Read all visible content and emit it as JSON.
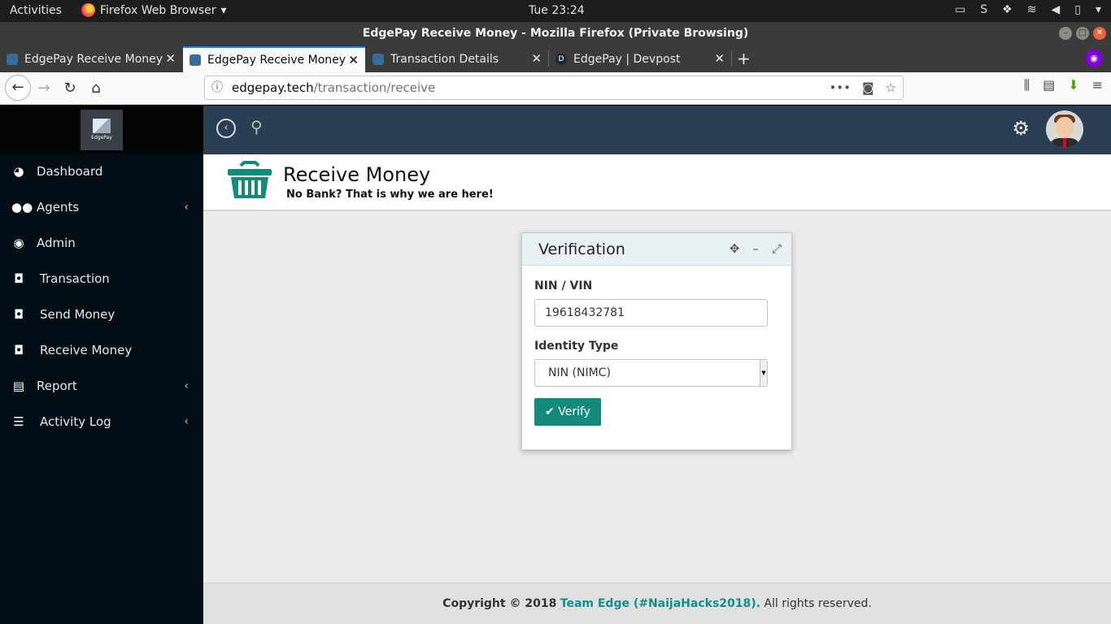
{
  "system": {
    "activities": "Activities",
    "app_menu": "Firefox Web Browser",
    "clock": "Tue 23:24"
  },
  "window": {
    "title": "EdgePay Receive Money - Mozilla Firefox (Private Browsing)"
  },
  "tabs": [
    {
      "label": "EdgePay Receive Money",
      "active": false
    },
    {
      "label": "EdgePay Receive Money",
      "active": true
    },
    {
      "label": "Transaction Details",
      "active": false
    },
    {
      "label": "EdgePay | Devpost",
      "active": false
    }
  ],
  "url": {
    "host": "edgepay.tech",
    "path": "/transaction/receive"
  },
  "brand": {
    "name": "EdgePay"
  },
  "sidebar": {
    "items": [
      {
        "label": "Dashboard",
        "icon": "dashboard-icon",
        "has_submenu": false
      },
      {
        "label": "Agents",
        "icon": "users-icon",
        "has_submenu": true
      },
      {
        "label": "Admin",
        "icon": "user-circle-icon",
        "has_submenu": false
      },
      {
        "label": "Transaction",
        "icon": "circle-dot-icon",
        "has_submenu": false
      },
      {
        "label": "Send Money",
        "icon": "circle-dot-icon",
        "has_submenu": false
      },
      {
        "label": "Receive Money",
        "icon": "circle-dot-icon",
        "has_submenu": false
      },
      {
        "label": "Report",
        "icon": "file-icon",
        "has_submenu": true
      },
      {
        "label": "Activity Log",
        "icon": "list-icon",
        "has_submenu": true
      }
    ]
  },
  "page": {
    "title": "Receive Money",
    "subtitle": "No Bank? That is why we are here!"
  },
  "verification": {
    "title": "Verification",
    "nin_label": "NIN / VIN",
    "nin_value": "19618432781",
    "identity_label": "Identity Type",
    "identity_selected": "NIN (NIMC)",
    "verify_label": "Verify"
  },
  "footer": {
    "copyright": "Copyright © 2018",
    "team": "Team Edge (#NaijaHacks2018).",
    "rights": "All rights reserved."
  },
  "colors": {
    "sidebar_bg": "#020e16",
    "header_bg": "#2a3e54",
    "accent": "#138a7a",
    "team_link": "#0f8f8f"
  }
}
